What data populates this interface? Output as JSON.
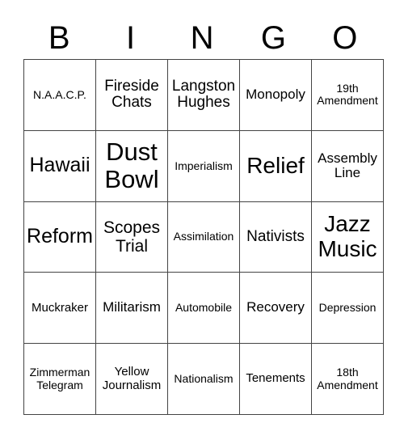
{
  "header": {
    "letters": [
      "B",
      "I",
      "N",
      "G",
      "O"
    ]
  },
  "rows": [
    [
      "N.A.A.C.P.",
      "Fireside Chats",
      "Langston Hughes",
      "Monopoly",
      "19th Amendment"
    ],
    [
      "Hawaii",
      "Dust Bowl",
      "Imperialism",
      "Relief",
      "Assembly Line"
    ],
    [
      "Reform",
      "Scopes Trial",
      "Assimilation",
      "Nativists",
      "Jazz Music"
    ],
    [
      "Muckraker",
      "Militarism",
      "Automobile",
      "Recovery",
      "Depression"
    ],
    [
      "Zimmerman Telegram",
      "Yellow Journalism",
      "Nationalism",
      "Tenements",
      "18th Amendment"
    ]
  ]
}
